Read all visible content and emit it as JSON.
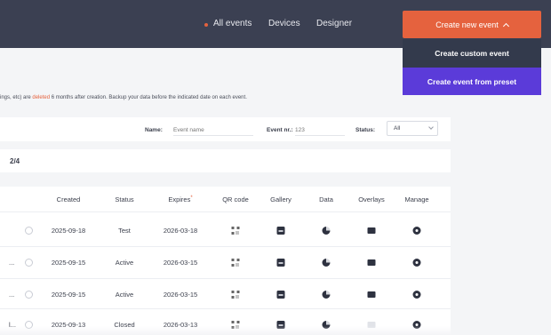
{
  "nav": {
    "items": [
      "All events",
      "Devices",
      "Designer"
    ],
    "create_button": "Create new event"
  },
  "dropdown": {
    "custom": "Create custom event",
    "preset": "Create event from preset"
  },
  "notice": {
    "before": "ings, etc) are ",
    "highlight": "deleted",
    "after": " 6 months after creation. Backup your data before the indicated date on each event."
  },
  "filters": {
    "name_label": "Name:",
    "name_placeholder": "Event name",
    "eventnr_label": "Event nr.:",
    "eventnr_placeholder": "123",
    "status_label": "Status:",
    "status_value": "All"
  },
  "pagination": {
    "page": "2/4"
  },
  "table": {
    "headers": {
      "created": "Created",
      "status": "Status",
      "expires": "Expires",
      "expires_mark": "*",
      "qr": "QR code",
      "gallery": "Gallery",
      "data": "Data",
      "overlays": "Overlays",
      "manage": "Manage"
    },
    "rows": [
      {
        "name": "",
        "created": "2025-09-18",
        "status": "Test",
        "expires": "2026-03-18",
        "overlays_enabled": true
      },
      {
        "name": "...",
        "created": "2025-09-15",
        "status": "Active",
        "expires": "2026-03-15",
        "overlays_enabled": true
      },
      {
        "name": "...",
        "created": "2025-09-15",
        "status": "Active",
        "expires": "2026-03-15",
        "overlays_enabled": true
      },
      {
        "name": "l...",
        "created": "2025-09-13",
        "status": "Closed",
        "expires": "2026-03-13",
        "overlays_enabled": false
      }
    ]
  },
  "colors": {
    "topbar": "#3b4052",
    "accent": "#e5623e",
    "preset_button": "#5b3bd9",
    "custom_button": "#333a4c"
  },
  "icons": {
    "qr": "qr-code-icon",
    "gallery": "gallery-icon",
    "data": "data-chart-icon",
    "overlays": "overlay-folder-icon",
    "manage": "gear-icon"
  }
}
